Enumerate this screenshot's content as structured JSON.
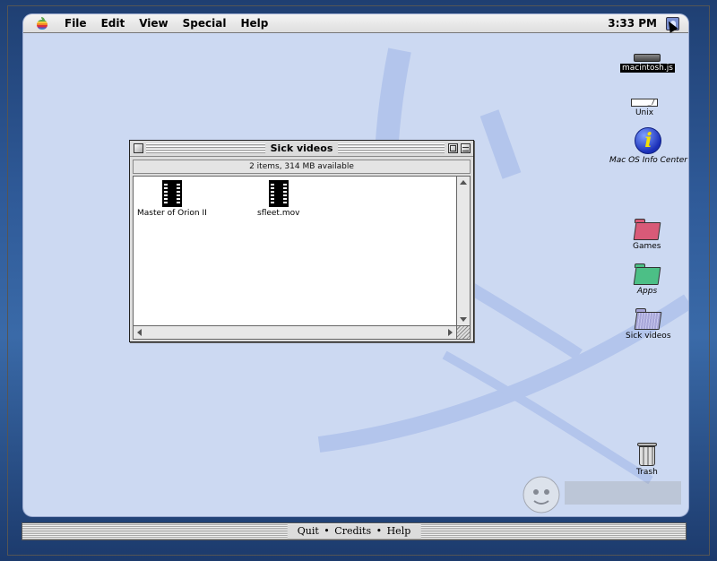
{
  "menubar": {
    "items": [
      "File",
      "Edit",
      "View",
      "Special",
      "Help"
    ],
    "clock": "3:33 PM"
  },
  "desktop": {
    "icons": {
      "macintosh": "macintosh.js",
      "unix": "Unix",
      "unix_badge": "_/",
      "info_center": "Mac OS Info Center",
      "info_glyph": "i",
      "games": "Games",
      "apps": "Apps",
      "sick_videos": "Sick videos",
      "trash": "Trash"
    },
    "colors": {
      "games_folder": "#d85a78",
      "apps_folder": "#4cbf86",
      "sick_videos_folder": "#a7a6d8"
    }
  },
  "window": {
    "title": "Sick videos",
    "info": "2 items, 314 MB available",
    "files": [
      "Master of Orion II",
      "sfleet.mov"
    ]
  },
  "bottombar": {
    "quit": "Quit",
    "sep1": "•",
    "credits": "Credits",
    "sep2": "•",
    "help": "Help"
  }
}
